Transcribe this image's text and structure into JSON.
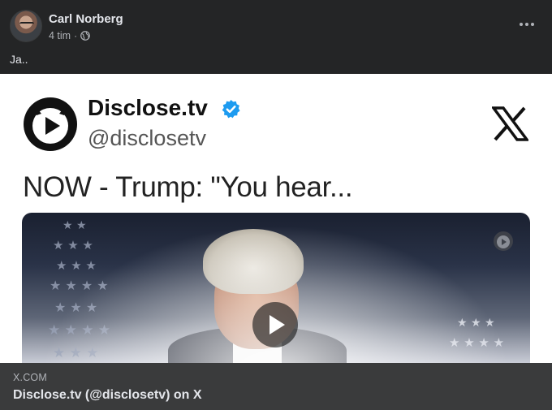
{
  "post": {
    "author": "Carl Norberg",
    "time": "4 tim",
    "separator": "·",
    "privacy_icon": "globe-icon",
    "caption": "Ja..",
    "more_icon": "more-options-icon"
  },
  "embed": {
    "account_name": "Disclose.tv",
    "handle": "@disclosetv",
    "tweet_text": "NOW - Trump: \"You hear...",
    "verified_color": "#1d9bf0",
    "x_logo": "x-logo-icon"
  },
  "link": {
    "domain": "X.COM",
    "title": "Disclose.tv (@disclosetv) on X"
  }
}
